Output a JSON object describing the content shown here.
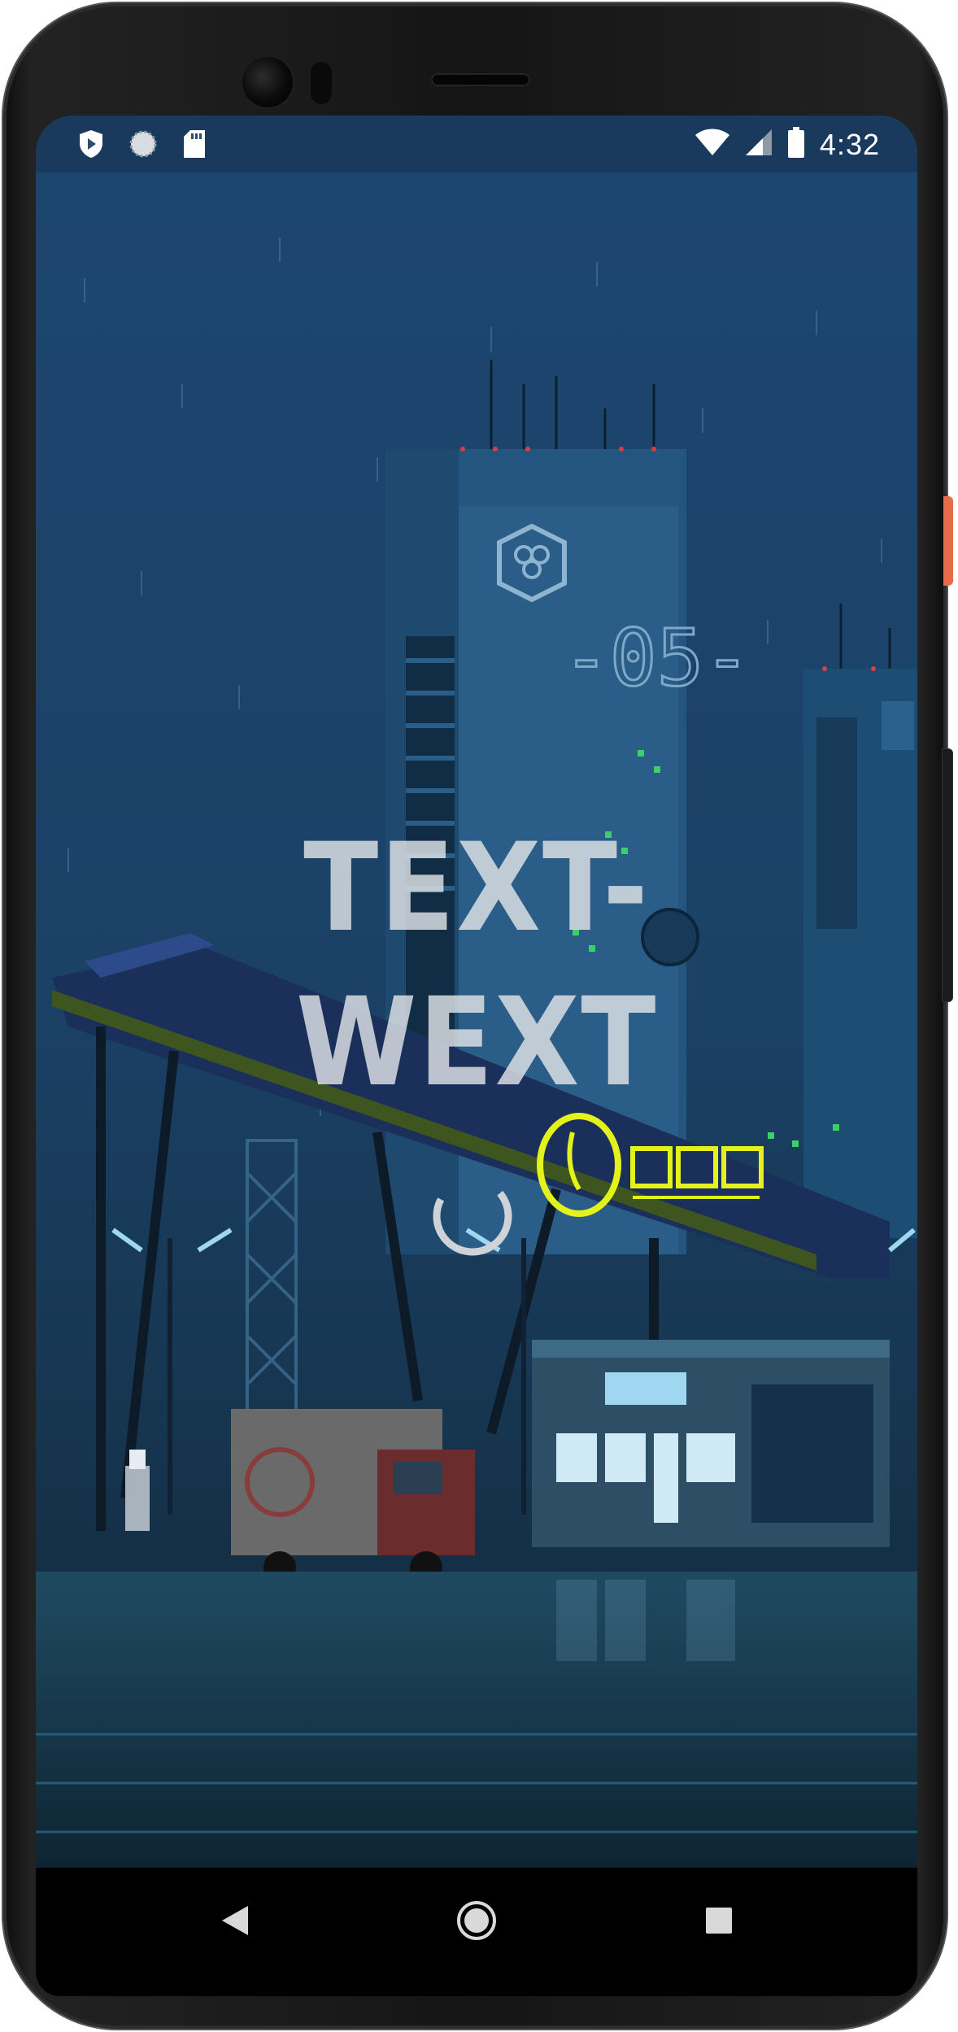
{
  "status_bar": {
    "time": "4:32",
    "left_icons": [
      "play-protect-icon",
      "sync-circle-icon",
      "sd-card-icon"
    ],
    "right_icons": [
      "wifi-icon",
      "cell-signal-icon",
      "battery-icon"
    ]
  },
  "app": {
    "title_line1": "TEXT-",
    "title_line2": "WEXT",
    "loading": true
  },
  "nav_bar": {
    "buttons": [
      "back-button",
      "home-button",
      "recents-button"
    ]
  },
  "colors": {
    "background": "#1a4063",
    "title": "#e1e4e8",
    "neon_sign": "#e4f21c",
    "spinner": "#cfd3d8"
  }
}
